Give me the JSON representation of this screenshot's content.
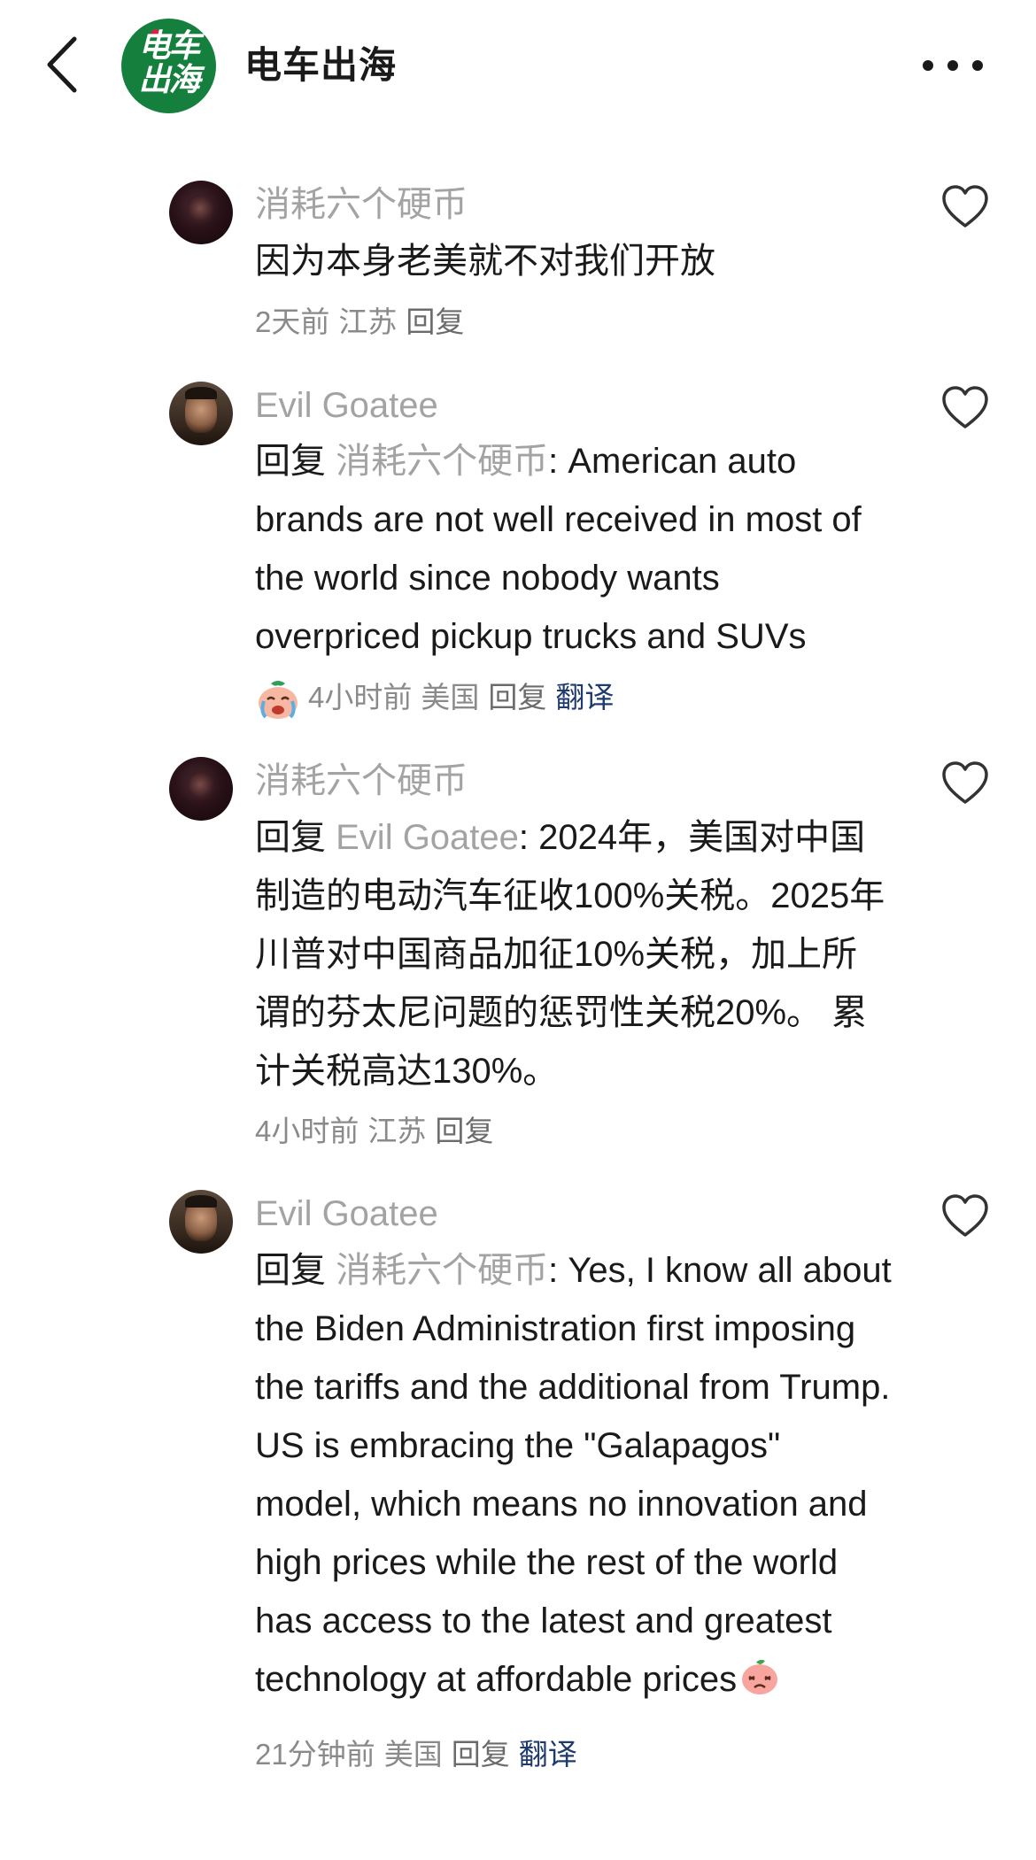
{
  "header": {
    "back_icon": "chevron-left-icon",
    "logo_line1": "电车",
    "logo_line2": "出海",
    "title": "电车出海",
    "more_icon": "more-horizontal-icon"
  },
  "colors": {
    "logo_green": "#15803d",
    "username_gray": "#a3a3a3",
    "meta_gray": "#8a8a8a",
    "translate_blue": "#1e3a6e",
    "text": "#1a1a1a"
  },
  "comments": [
    {
      "username": "消耗六个硬币",
      "avatar": "dark-avatar",
      "text": "因为本身老美就不对我们开放",
      "time": "2天前",
      "location": "江苏",
      "reply_label": "回复",
      "like_icon": "heart-outline-icon"
    },
    {
      "username": "Evil Goatee",
      "avatar": "portrait-avatar",
      "reply_prefix": "回复 ",
      "reply_target": "消耗六个硬币",
      "text": ": American auto brands are not well received in most of the world since nobody wants overpriced pickup trucks and SUVs",
      "meta_emoji": "crying-face-emoji",
      "time": "4小时前",
      "location": "美国",
      "reply_label": "回复",
      "translate_label": "翻译",
      "like_icon": "heart-outline-icon"
    },
    {
      "username": "消耗六个硬币",
      "avatar": "dark-avatar",
      "reply_prefix": "回复 ",
      "reply_target": "Evil Goatee",
      "text": ": 2024年，美国对中国制造的电动汽车征收100%关税。2025年川普对中国商品加征10%关税，加上所谓的芬太尼问题的惩罚性关税20%。 累计关税高达130%。",
      "time": "4小时前",
      "location": "江苏",
      "reply_label": "回复",
      "like_icon": "heart-outline-icon"
    },
    {
      "username": "Evil Goatee",
      "avatar": "portrait-avatar",
      "reply_prefix": "回复 ",
      "reply_target": "消耗六个硬币",
      "text": ": Yes, I know all about the Biden Administration first imposing the tariffs and the additional from Trump. US is embracing the \"Galapagos\" model, which means no innovation and high prices while the rest of the world has access to the latest and greatest technology at affordable prices",
      "trailing_emoji": "sad-peach-emoji",
      "time": "21分钟前",
      "location": "美国",
      "reply_label": "回复",
      "translate_label": "翻译",
      "like_icon": "heart-outline-icon"
    }
  ]
}
